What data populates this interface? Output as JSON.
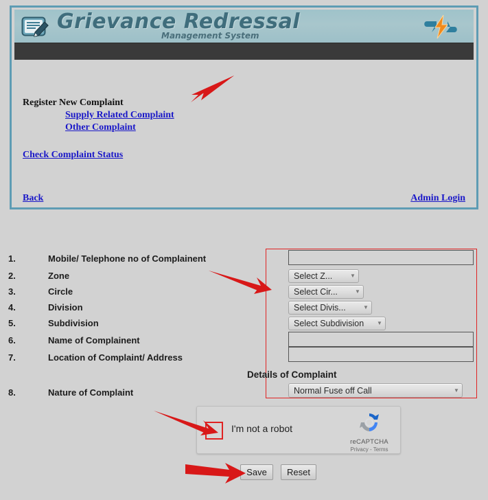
{
  "app": {
    "title": "Grievance Redressal",
    "subtitle": "Management System",
    "logo_left": "document-pencil-icon",
    "logo_right": "lightning-bolt-icon",
    "theme": {
      "border": "#5e9cb4",
      "header_bg": "#a4c4cb",
      "navbar_bg": "#3a3a3a",
      "page_bg": "#d2d2d2",
      "link_color": "#1a18c8",
      "annotation_color": "#e02222"
    }
  },
  "nav": {
    "register_heading": "Register New Complaint",
    "links": [
      {
        "id": "supply",
        "label": "Supply Related Complaint"
      },
      {
        "id": "other",
        "label": "Other Complaint"
      },
      {
        "id": "status",
        "label": "Check Complaint Status"
      }
    ],
    "back_label": "Back",
    "admin_label": "Admin Login"
  },
  "form": {
    "fields": [
      {
        "num": "1.",
        "label": "Mobile/ Telephone no of Complainent",
        "type": "text",
        "value": ""
      },
      {
        "num": "2.",
        "label": "Zone",
        "type": "select",
        "value": "Select Z..."
      },
      {
        "num": "3.",
        "label": "Circle",
        "type": "select",
        "value": "Select Cir..."
      },
      {
        "num": "4.",
        "label": "Division",
        "type": "select",
        "value": "Select Divis..."
      },
      {
        "num": "5.",
        "label": "Subdivision",
        "type": "select",
        "value": "Select Subdivision"
      },
      {
        "num": "6.",
        "label": "Name of Complainent",
        "type": "text",
        "value": ""
      },
      {
        "num": "7.",
        "label": "Location of Complaint/ Address",
        "type": "text",
        "value": ""
      },
      {
        "num": "8.",
        "label": "Nature of Complaint",
        "type": "select",
        "value": "Normal Fuse off Call"
      }
    ],
    "details_heading": "Details of Complaint",
    "save_label": "Save",
    "reset_label": "Reset"
  },
  "recaptcha": {
    "checkbox_label": "I'm not a robot",
    "brand": "reCAPTCHA",
    "terms": "Privacy - Terms",
    "logo": "recaptcha-logo-icon",
    "checked": false
  },
  "annotations": [
    {
      "id": "arrow-supply",
      "target": "supply-related-complaint-link"
    },
    {
      "id": "arrow-zone",
      "target": "inputs-highlight-box"
    },
    {
      "id": "arrow-captcha",
      "target": "recaptcha-checkbox"
    },
    {
      "id": "arrow-save",
      "target": "save-button"
    }
  ]
}
